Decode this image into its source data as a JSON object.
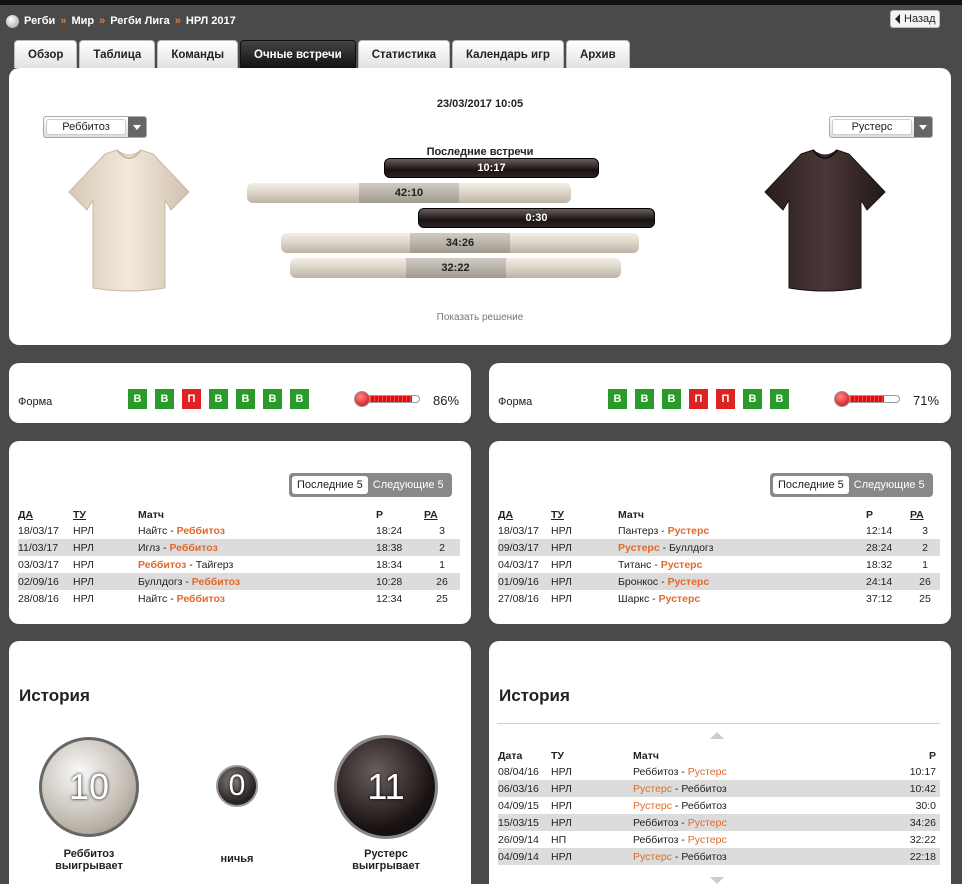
{
  "breadcrumbs": [
    "Регби",
    "Мир",
    "Регби Лига",
    "НРЛ 2017"
  ],
  "breadcrumb_sep": "»",
  "back_label": "Назад",
  "tabs": [
    "Обзор",
    "Таблица",
    "Команды",
    "Очные встречи",
    "Статистика",
    "Календарь игр",
    "Архив"
  ],
  "active_tab": "Очные встречи",
  "header": {
    "datetime": "23/03/2017 10:05",
    "home_select": "Реббитоз",
    "away_select": "Рустерс",
    "last_meetings_title": "Последние встречи",
    "scores": [
      "10:17",
      "42:10",
      "0:30",
      "34:26",
      "32:22"
    ],
    "show_solution": "Показать решение",
    "home_shirt_color": "#ede2d3",
    "away_shirt_color": "#3b2c2c"
  },
  "form": {
    "label": "Форма",
    "home": {
      "results": [
        "В",
        "В",
        "П",
        "В",
        "В",
        "В",
        "В"
      ],
      "percent": "86%"
    },
    "away": {
      "results": [
        "В",
        "В",
        "В",
        "П",
        "П",
        "В",
        "В"
      ],
      "percent": "71%"
    }
  },
  "matches": {
    "toggle_last": "Последние 5",
    "toggle_next": "Следующие 5",
    "headers": {
      "date": "ДА",
      "tour": "ТУ",
      "match": "Матч",
      "score": "Р",
      "pa": "РА"
    },
    "home": [
      {
        "date": "18/03/17",
        "tour": "НРЛ",
        "team1": "Найтс",
        "team2": "Реббитоз",
        "score": "18:24",
        "pa": "3"
      },
      {
        "date": "11/03/17",
        "tour": "НРЛ",
        "team1": "Иглз",
        "team2": "Реббитоз",
        "score": "18:38",
        "pa": "2"
      },
      {
        "date": "03/03/17",
        "tour": "НРЛ",
        "team1": "Реббитоз",
        "team2": "Тайгерз",
        "score": "18:34",
        "pa": "1"
      },
      {
        "date": "02/09/16",
        "tour": "НРЛ",
        "team1": "Буллдогз",
        "team2": "Реббитоз",
        "score": "10:28",
        "pa": "26"
      },
      {
        "date": "28/08/16",
        "tour": "НРЛ",
        "team1": "Найтс",
        "team2": "Реббитоз",
        "score": "12:34",
        "pa": "25"
      }
    ],
    "away": [
      {
        "date": "18/03/17",
        "tour": "НРЛ",
        "team1": "Пантерз",
        "team2": "Рустерс",
        "score": "12:14",
        "pa": "3"
      },
      {
        "date": "09/03/17",
        "tour": "НРЛ",
        "team1": "Рустерс",
        "team2": "Буллдогз",
        "score": "28:24",
        "pa": "2"
      },
      {
        "date": "04/03/17",
        "tour": "НРЛ",
        "team1": "Титанс",
        "team2": "Рустерс",
        "score": "18:32",
        "pa": "1"
      },
      {
        "date": "01/09/16",
        "tour": "НРЛ",
        "team1": "Бронкос",
        "team2": "Рустерс",
        "score": "24:14",
        "pa": "26"
      },
      {
        "date": "27/08/16",
        "tour": "НРЛ",
        "team1": "Шаркс",
        "team2": "Рустерс",
        "score": "37:12",
        "pa": "25"
      }
    ]
  },
  "history": {
    "title": "История",
    "home_wins": "10",
    "draws": "0",
    "away_wins": "11",
    "home_label": "Реббитоз выигрывает",
    "draw_label": "ничья",
    "away_label": "Рустерс выигрывает",
    "headers": {
      "date": "Дата",
      "tour": "ТУ",
      "match": "Матч",
      "score": "Р"
    },
    "rows": [
      {
        "date": "08/04/16",
        "tour": "НРЛ",
        "team1": "Реббитоз",
        "team2": "Рустерс",
        "score": "10:17"
      },
      {
        "date": "06/03/16",
        "tour": "НРЛ",
        "team1": "Рустерс",
        "team2": "Реббитоз",
        "score": "10:42"
      },
      {
        "date": "04/09/15",
        "tour": "НРЛ",
        "team1": "Рустерс",
        "team2": "Реббитоз",
        "score": "30:0"
      },
      {
        "date": "15/03/15",
        "tour": "НРЛ",
        "team1": "Реббитоз",
        "team2": "Рустерс",
        "score": "34:26"
      },
      {
        "date": "26/09/14",
        "tour": "НП",
        "team1": "Реббитоз",
        "team2": "Рустерс",
        "score": "32:22"
      },
      {
        "date": "04/09/14",
        "tour": "НРЛ",
        "team1": "Рустерс",
        "team2": "Реббитоз",
        "score": "22:18"
      }
    ]
  }
}
